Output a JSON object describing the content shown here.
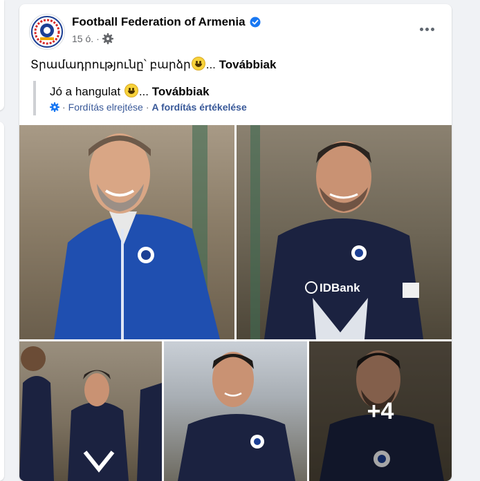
{
  "post": {
    "page_name": "Football Federation of Armenia",
    "time": "15 ó.",
    "dot": "·",
    "text": "Տրամադրությունը՝ բարձր",
    "ellipsis": "...",
    "see_more": "Továbbiak",
    "translation": {
      "text": "Jó a hangulat",
      "ellipsis": "...",
      "see_more": "Továbbiak",
      "hide_label": "Fordítás elrejtése",
      "separator": "·",
      "rate_label": "A fordítás értékelése"
    },
    "more_photos": "+4"
  },
  "icons": {
    "verified": "verified-badge-icon",
    "privacy": "gear-icon",
    "translate": "gear-icon",
    "more": "more-options-icon"
  },
  "colors": {
    "brand_blue": "#1877f2",
    "link": "#385898",
    "secondary_text": "#65676b"
  }
}
